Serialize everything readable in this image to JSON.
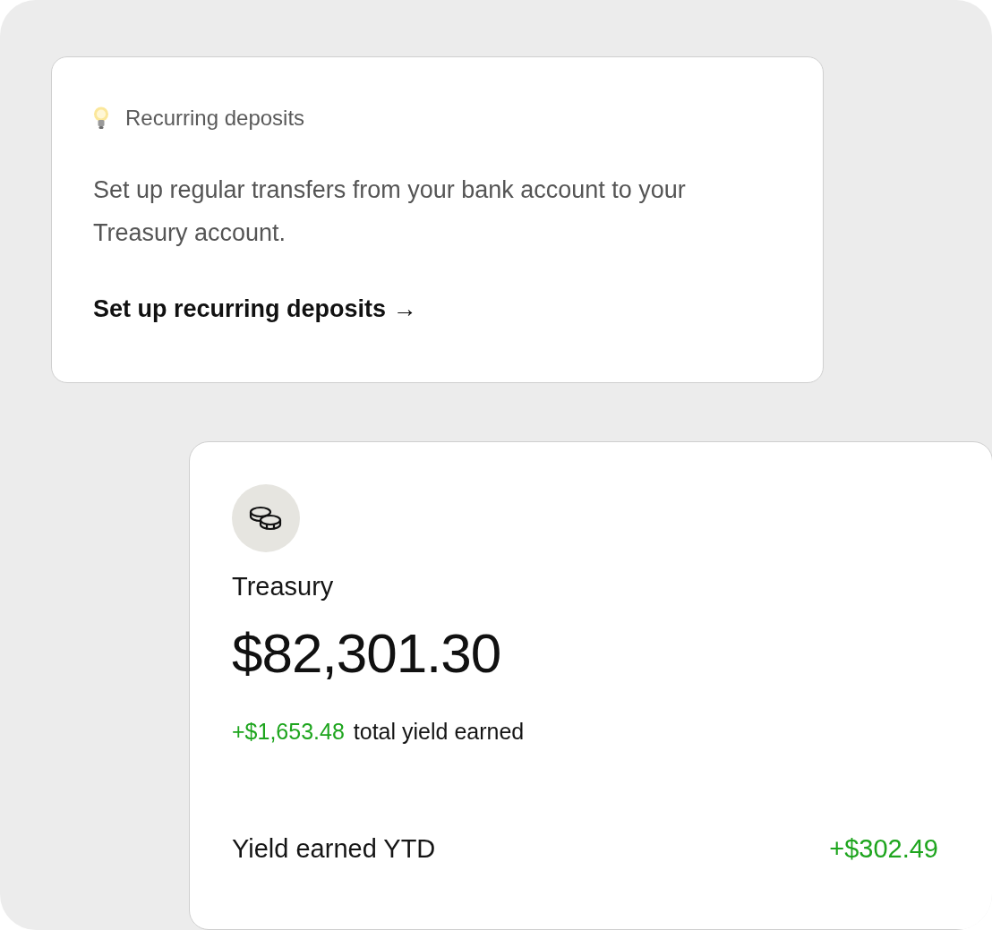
{
  "tip_card": {
    "title": "Recurring deposits",
    "body": "Set up regular transfers from your bank account to your Treasury account.",
    "link": "Set up recurring deposits →"
  },
  "account_card": {
    "name": "Treasury",
    "balance": "$82,301.30",
    "yield_amount": "+$1,653.48",
    "yield_label": "total yield earned",
    "rows": [
      {
        "label": "Yield earned YTD",
        "value": "+$302.49"
      }
    ]
  }
}
